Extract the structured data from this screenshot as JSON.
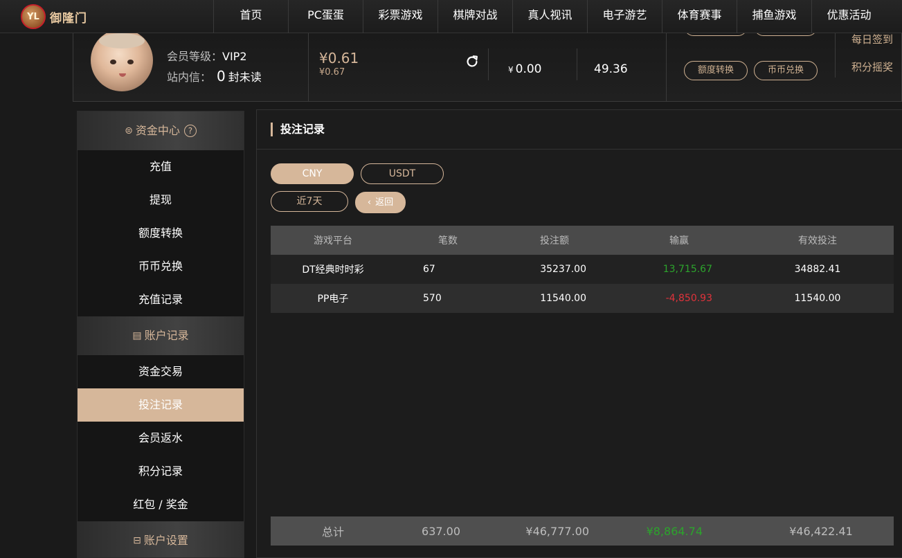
{
  "brand": {
    "logo_mark": "YL",
    "logo_text": "御隆门"
  },
  "nav": {
    "items": [
      {
        "label": "首页",
        "width": 108
      },
      {
        "label": "PC蛋蛋",
        "width": 108
      },
      {
        "label": "彩票游戏",
        "width": 108
      },
      {
        "label": "棋牌对战",
        "width": 108
      },
      {
        "label": "真人视讯",
        "width": 108
      },
      {
        "label": "电子游艺",
        "width": 108
      },
      {
        "label": "体育赛事",
        "width": 108
      },
      {
        "label": "捕鱼游戏",
        "width": 108
      },
      {
        "label": "优惠活动",
        "width": 108
      }
    ]
  },
  "user": {
    "level_label": "会员等级：",
    "level_value": "VIP2",
    "message_label": "站内信：",
    "unread_count": "0",
    "unread_suffix": "封未读",
    "balance_main": "¥0.61",
    "balance_sub": "¥0.67",
    "stat_1_currency": "¥",
    "stat_1_value": "0.00",
    "stat_2_value": "49.36",
    "btn_transfer": "额度转换",
    "btn_exchange": "币币兑换",
    "link_checkin": "每日签到",
    "link_points_lottery": "积分摇奖"
  },
  "sidebar": {
    "section_funds": "资金中心",
    "funds_items": [
      "充值",
      "提现",
      "额度转换",
      "币币兑换",
      "充值记录"
    ],
    "section_records": "账户记录",
    "records_items": [
      "资金交易",
      "投注记录",
      "会员返水",
      "积分记录",
      "红包 / 奖金"
    ],
    "active_item": "投注记录",
    "section_settings": "账户设置"
  },
  "main": {
    "title": "投注记录",
    "currency_tabs": {
      "cny": "CNY",
      "usdt": "USDT",
      "selected": "CNY"
    },
    "range_label": "近7天",
    "back_label": "返回"
  },
  "bets_table": {
    "columns": [
      "游戏平台",
      "笔数",
      "投注额",
      "输赢",
      "有效投注"
    ],
    "rows": [
      [
        "DT经典时时彩",
        "67",
        "35237.00",
        "13,715.67",
        "34882.41"
      ],
      [
        "PP电子",
        "570",
        "11540.00",
        "-4,850.93",
        "11540.00"
      ]
    ],
    "totals": [
      "总计",
      "637.00",
      "¥46,777.00",
      "¥8,864.74",
      "¥46,422.41"
    ]
  },
  "colors": {
    "accent": "#d6b79a",
    "win": "#2ca42c",
    "loss": "#e0333b"
  }
}
